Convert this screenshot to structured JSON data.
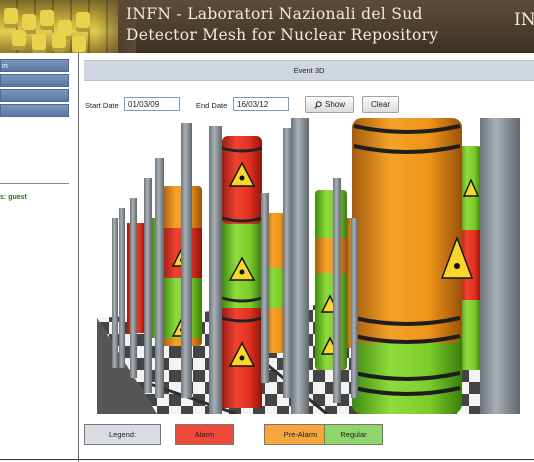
{
  "header": {
    "title_line1": "INFN - Laboratori Nazionali del Sud",
    "title_line2": "Detector Mesh for Nuclear Repository",
    "logo_text": "INI"
  },
  "sidebar": {
    "items": [
      {
        "label": "m"
      },
      {
        "label": ""
      },
      {
        "label": ""
      },
      {
        "label": ""
      }
    ],
    "user_prefix": "s:",
    "user_name": "guest"
  },
  "main": {
    "panel_title": "Event 3D",
    "start_label": "Start Date",
    "start_value": "01/03/09",
    "end_label": "End Date",
    "end_value": "16/03/12",
    "show_label": "Show",
    "clear_label": "Clear"
  },
  "legend": {
    "label": "Legend:",
    "alarm": "Alarm",
    "prealarm": "Pre-Alarm",
    "regular": "Regular"
  },
  "colors": {
    "alarm": "#f04a3a",
    "prealarm": "#f7a53e",
    "regular": "#8fd66a",
    "legend_bg": "#d9dde2",
    "drum_alarm": "#e8372a",
    "drum_prealarm": "#f19a1f",
    "drum_regular": "#7fcf2c"
  }
}
